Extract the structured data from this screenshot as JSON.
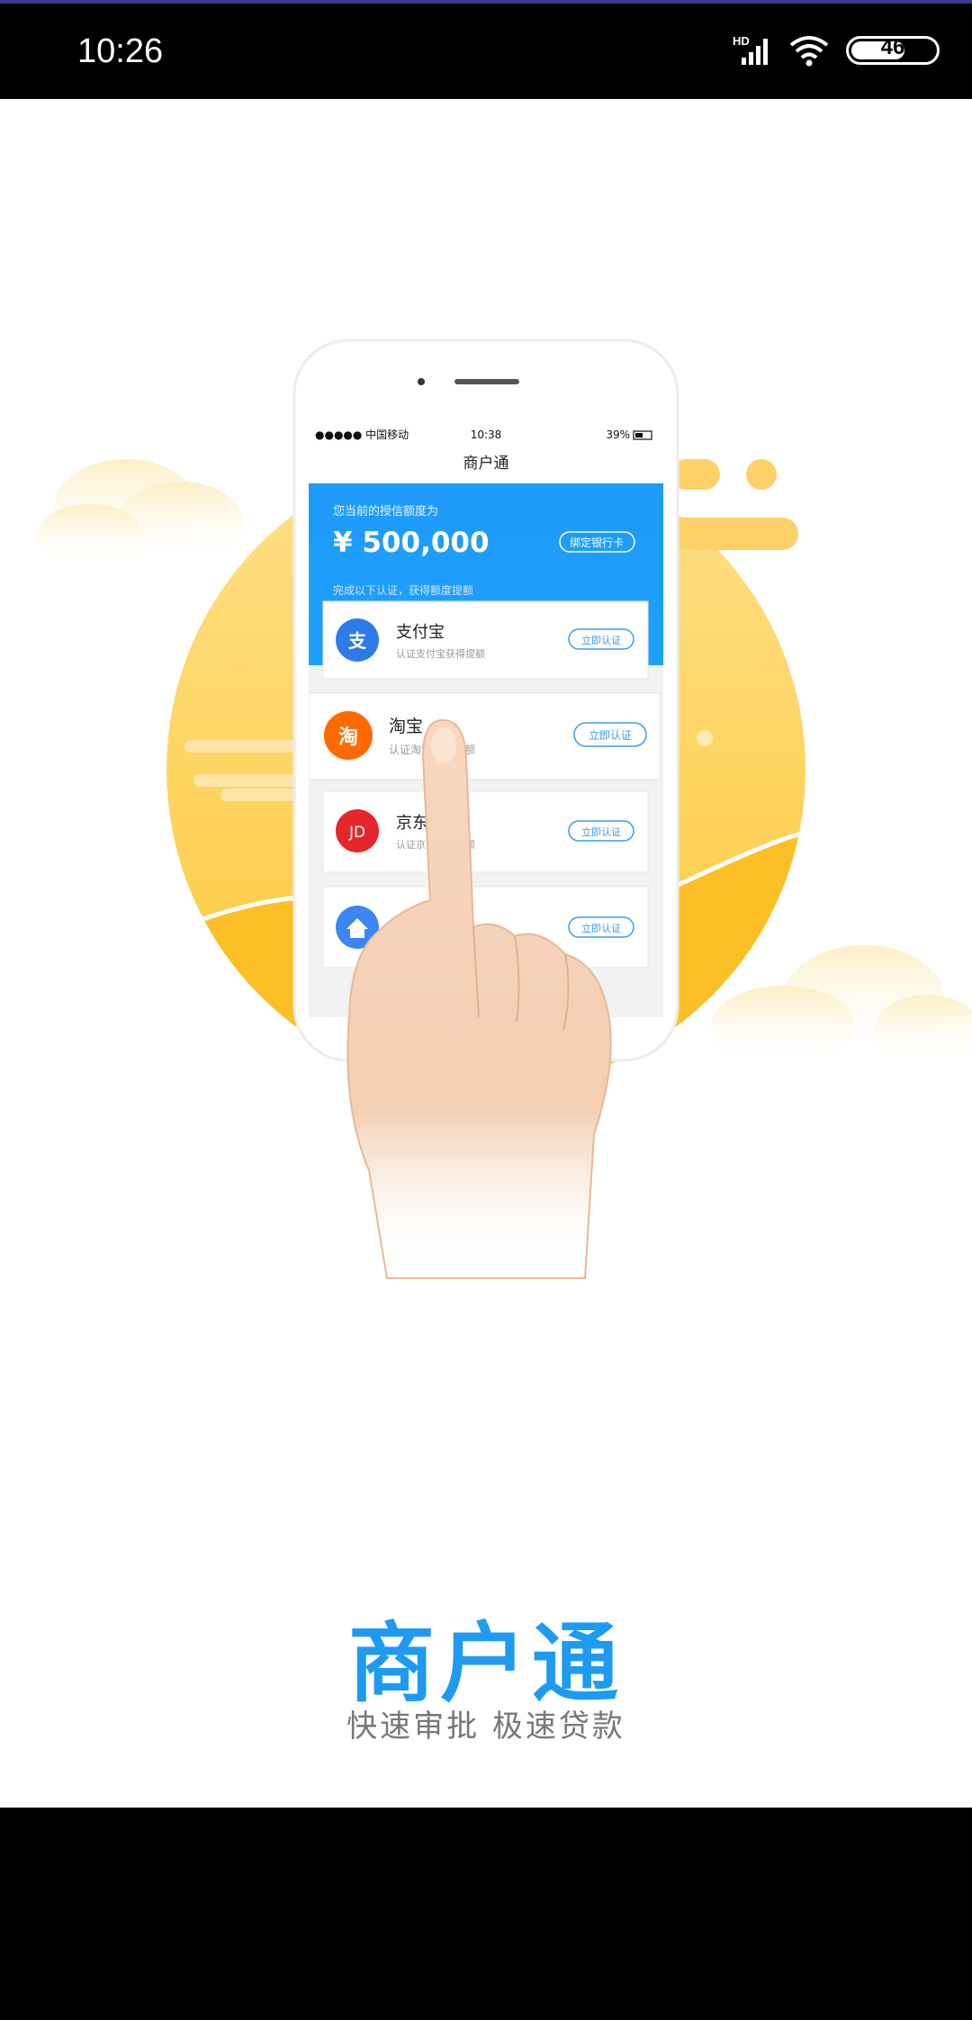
{
  "status_bar": {
    "time": "10:26",
    "network": "HD",
    "battery": "46"
  },
  "mock_phone": {
    "carrier": "●●●●● 中国移动",
    "time": "10:38",
    "battery": "39%",
    "app_title": "商户通",
    "credit_label": "您当前的授信额度为",
    "credit_amount": "¥ 500,000",
    "bind_card_button": "绑定银行卡",
    "hint": "完成以下认证，获得额度提额",
    "items": [
      {
        "icon_text": "支",
        "title": "支付宝",
        "desc": "认证支付宝获得提额",
        "action": "立即认证",
        "color": "#2e7be8"
      },
      {
        "icon_text": "淘",
        "title": "淘宝",
        "desc": "认证淘宝获得提额",
        "action": "立即认证",
        "color": "#ff6a00"
      },
      {
        "icon_text": "JD",
        "title": "京东",
        "desc": "认证京东获得提额",
        "action": "立即认证",
        "color": "#e5262b"
      },
      {
        "icon_text": "",
        "title": "",
        "desc": "",
        "action": "立即认证",
        "color": "#3b86f0"
      }
    ]
  },
  "brand": {
    "title": "商户通",
    "subtitle": "快速审批  极速贷款"
  },
  "colors": {
    "accent": "#1e9bf0",
    "sun": "#fcc93a",
    "blue_header": "#1f9bfa"
  }
}
